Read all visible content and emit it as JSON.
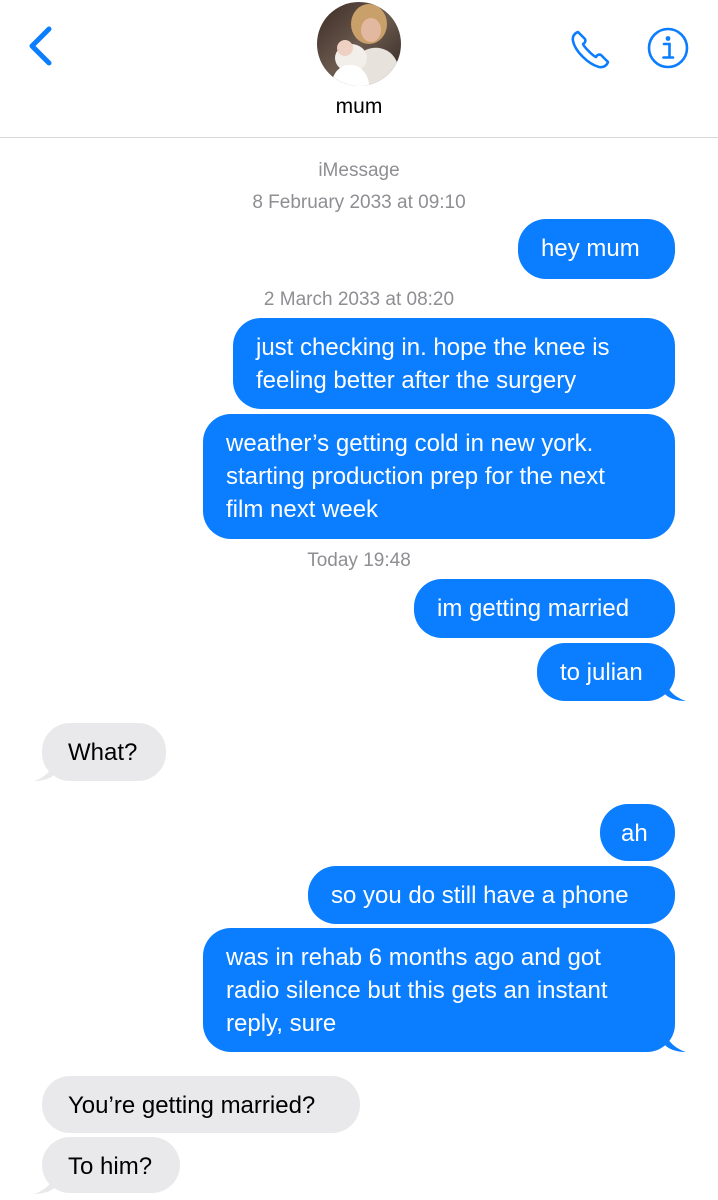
{
  "header": {
    "contact_name": "mum",
    "icons": {
      "back": "chevron-left-icon",
      "call": "phone-icon",
      "info": "info-icon"
    },
    "accent_color": "#0b7dff"
  },
  "conversation": {
    "service_label": "iMessage",
    "timestamps": {
      "first": "8 February 2033 at 09:10",
      "second": "2 March 2033 at 08:20",
      "third": "Today 19:48"
    },
    "messages": [
      {
        "from": "me",
        "text": "hey mum"
      },
      {
        "from": "me",
        "lines": [
          "just checking in. hope the knee is",
          "feeling better after the surgery"
        ]
      },
      {
        "from": "me",
        "lines": [
          "weather’s getting cold in new york.",
          "starting production prep for the next",
          "film next week"
        ]
      },
      {
        "from": "me",
        "text": "im getting married"
      },
      {
        "from": "me",
        "text": "to julian"
      },
      {
        "from": "mum",
        "text": "What?"
      },
      {
        "from": "me",
        "text": "ah"
      },
      {
        "from": "me",
        "text": "so you do still have a phone"
      },
      {
        "from": "me",
        "lines": [
          "was in rehab 6 months ago and got",
          "radio silence but this gets an instant",
          "reply, sure"
        ]
      },
      {
        "from": "mum",
        "text": "You’re getting married?"
      },
      {
        "from": "mum",
        "text": "To him?"
      }
    ],
    "colors": {
      "outgoing": "#0b7dff",
      "incoming": "#e9e9eb",
      "timestamp": "#8e8e93"
    }
  }
}
